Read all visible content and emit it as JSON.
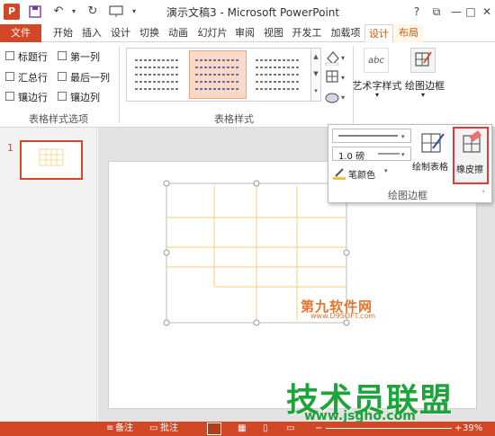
{
  "title_bar": {
    "app_logo": "P",
    "title": "演示文稿3 - Microsoft PowerPoint",
    "help": "?",
    "minimize": "—",
    "restore": "□",
    "close": "✕"
  },
  "tabs": [
    "文件",
    "开始",
    "插入",
    "设计",
    "切换",
    "动画",
    "幻灯片",
    "审阅",
    "视图",
    "开发工",
    "加载项",
    "设计",
    "布局"
  ],
  "style_options": {
    "items": [
      "标题行",
      "第一列",
      "汇总行",
      "最后一列",
      "镶边行",
      "镶边列"
    ],
    "group_label": "表格样式选项"
  },
  "table_styles": {
    "group_label": "表格样式"
  },
  "wordart": {
    "preview": "abc",
    "label": "艺术字样式"
  },
  "draw_borders": {
    "label": "绘图边框",
    "pen_weight": "1.0 磅",
    "pen_color": "笔颜色",
    "draw_table": "绘制表格",
    "eraser": "橡皮擦",
    "group_label": "绘图边框"
  },
  "thumbnail": {
    "slide_number": "1"
  },
  "status_bar": {
    "notes": "备注",
    "comments": "批注",
    "zoom": "39%"
  },
  "watermarks": {
    "site_cn": "第九软件网",
    "site_url": "www.D9SOFT.com",
    "brand": "技术员联盟",
    "brand_url": "www.jsgho.com"
  },
  "colors": {
    "accent": "#d24726",
    "eraser_highlight": "#e53935",
    "table_lines": "#f2d279"
  }
}
